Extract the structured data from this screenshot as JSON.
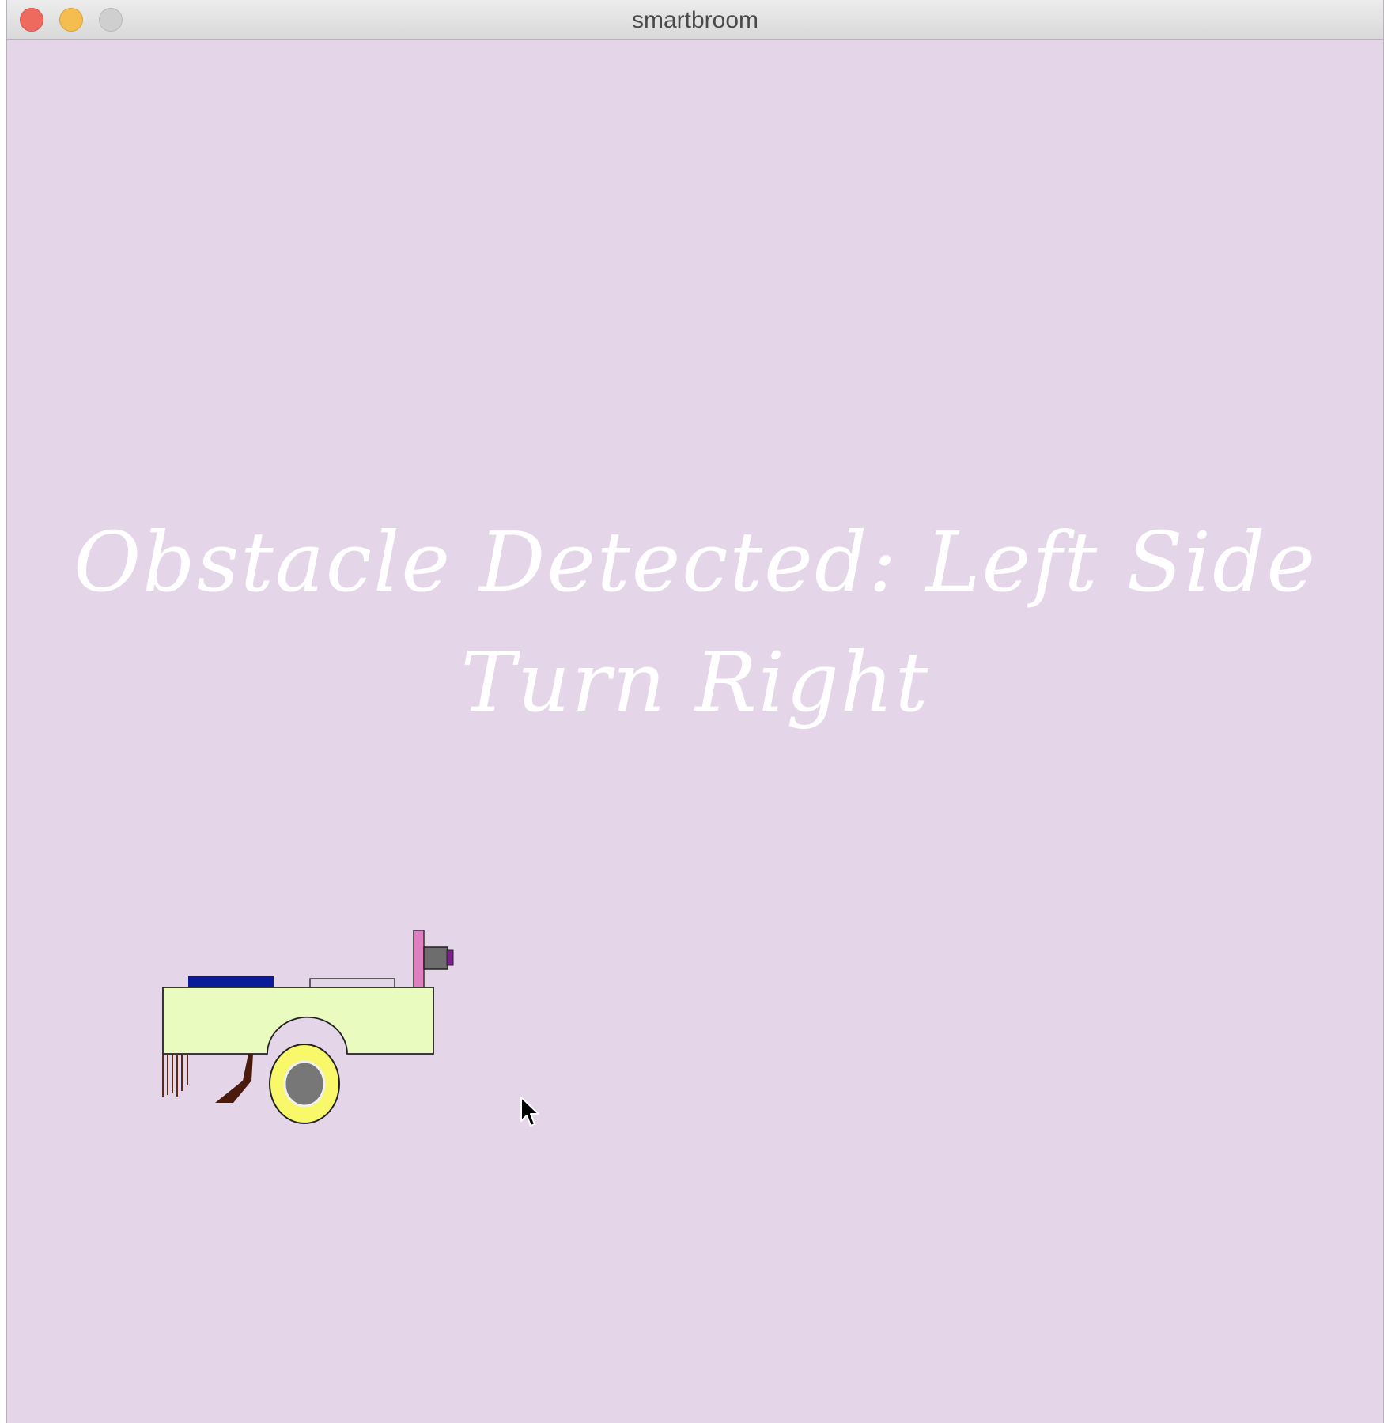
{
  "window": {
    "title": "smartbroom"
  },
  "canvas": {
    "background": "#e4d6e8",
    "status_line1": "Obstacle Detected: Left Side",
    "status_line2": "Turn Right"
  },
  "robot": {
    "body_color": "#eafbc0",
    "wheel_color": "#f8f86a",
    "hub_color": "#777777",
    "lid_color": "#0a1b9a",
    "mast_color": "#e07fc0"
  },
  "icons": {
    "cursor": "arrow-cursor-icon"
  }
}
